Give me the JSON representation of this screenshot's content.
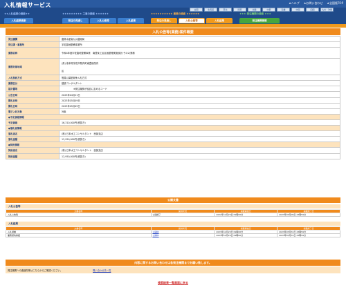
{
  "header": {
    "app_title": "入札情報サービス",
    "toplinks": [
      "★ヘルプ",
      "★お問い合わせ",
      "★全国版TOP"
    ],
    "regions": [
      "全国",
      "北海道",
      "東北",
      "関東",
      "北陸",
      "中部",
      "近畿",
      "中国",
      "四国",
      "九州・沖縄"
    ],
    "section_titles": {
      "nyusatsu": "★★入札結果の検索★★",
      "koji": "★★★★★★★★★ 工事の検索 ★★★★★★",
      "gyomu": "★★★★★★★★★★ 業務の検索 ★★★★★★",
      "hatchu": "★★★ 発注機関の検索 ★★★"
    },
    "tabs": [
      {
        "label": "入札結果検索",
        "color": "blue"
      },
      {
        "label": "発注の見通し",
        "color": "blue"
      },
      {
        "label": "入札公告等",
        "color": "blue"
      },
      {
        "label": "入札結果",
        "color": "blue"
      },
      {
        "label": "発注の見通し",
        "color": "orange"
      },
      {
        "label": "入札公告等",
        "color": "orange-active"
      },
      {
        "label": "入札結果",
        "color": "orange"
      },
      {
        "label": "発注機関情報",
        "color": "green"
      }
    ]
  },
  "panel_title": "入札公告等(業務)案件概要",
  "details": [
    {
      "label": "発注機関",
      "value": "農林水産省九州農政局"
    },
    {
      "label": "発注課・事務所",
      "value": "宇佐農地整備事業所"
    },
    {
      "label": "業務名称",
      "value": "令和4年度宇佐農地整備事業　南豊後工区区画整理実施設計(その2)業務"
    },
    {
      "label": "業務対象地域",
      "value": "(県) 熊本県宇佐市院内町南豊後院内",
      "value2": "区"
    },
    {
      "label": "入札契約方式",
      "value": "簡易公募型競争入札方式"
    },
    {
      "label": "業務区分",
      "value": "建設コンサルタント"
    },
    {
      "label": "設計書等",
      "value": "※発注機関が独自に定めるコード"
    },
    {
      "label": "公告日時",
      "value": "2023年04月21日"
    },
    {
      "label": "開札日時",
      "value": "2023年05月09日"
    },
    {
      "label": "開札日時",
      "value": "2023年05月09日"
    },
    {
      "label": "電子入札対象",
      "value": "対象"
    }
  ],
  "groups": {
    "yotei": "●予定価格情報",
    "rakusatsu": "●落札者情報",
    "keiyaku": "●契約情報"
  },
  "yotei_rows": [
    {
      "label": "予定価格",
      "value": "16,310,000円(税抜き)"
    }
  ],
  "rakusatsu_rows": [
    {
      "label": "落札者名",
      "value": "(株) 日本水工コンサルタント　西部支店"
    },
    {
      "label": "落札金額",
      "value": "12,950,000円(税抜き)"
    }
  ],
  "keiyaku_rows": [
    {
      "label": "契約者名",
      "value": "(株) 日本水工コンサルタント　西部支店"
    },
    {
      "label": "契約金額",
      "value": "12,950,000円(税抜き)"
    }
  ],
  "documents": {
    "title": "公開文書",
    "columns": [
      "文書名称",
      "提供状況",
      "掲載開始日",
      "掲載終了日"
    ],
    "koukoku": {
      "heading": "入札公告等",
      "rows": [
        {
          "name": "入札公告等",
          "status": "公開終了",
          "start": "2022年12月20日 09時00分",
          "end": "2023年05月09日 23時59分"
        }
      ]
    },
    "kekka": {
      "heading": "入札結果",
      "rows": [
        {
          "name": "入札調書",
          "status": "公開中",
          "start": "2023年12月20日 09時00分",
          "end": "2023年05月31日 23時59分"
        },
        {
          "name": "業務契約締結",
          "status": "公開中",
          "start": "2023年12月20日 09時00分",
          "end": "2023年05月31日 23時59分"
        }
      ]
    }
  },
  "contact": {
    "title": "内容に関するお問い合わせは各発注機関までお願い致します。",
    "label": "発注機関への連絡先等はこちらからご確認ください。",
    "link": "問い合わせ先一覧"
  },
  "back_link": "検索結果一覧画面に戻る"
}
